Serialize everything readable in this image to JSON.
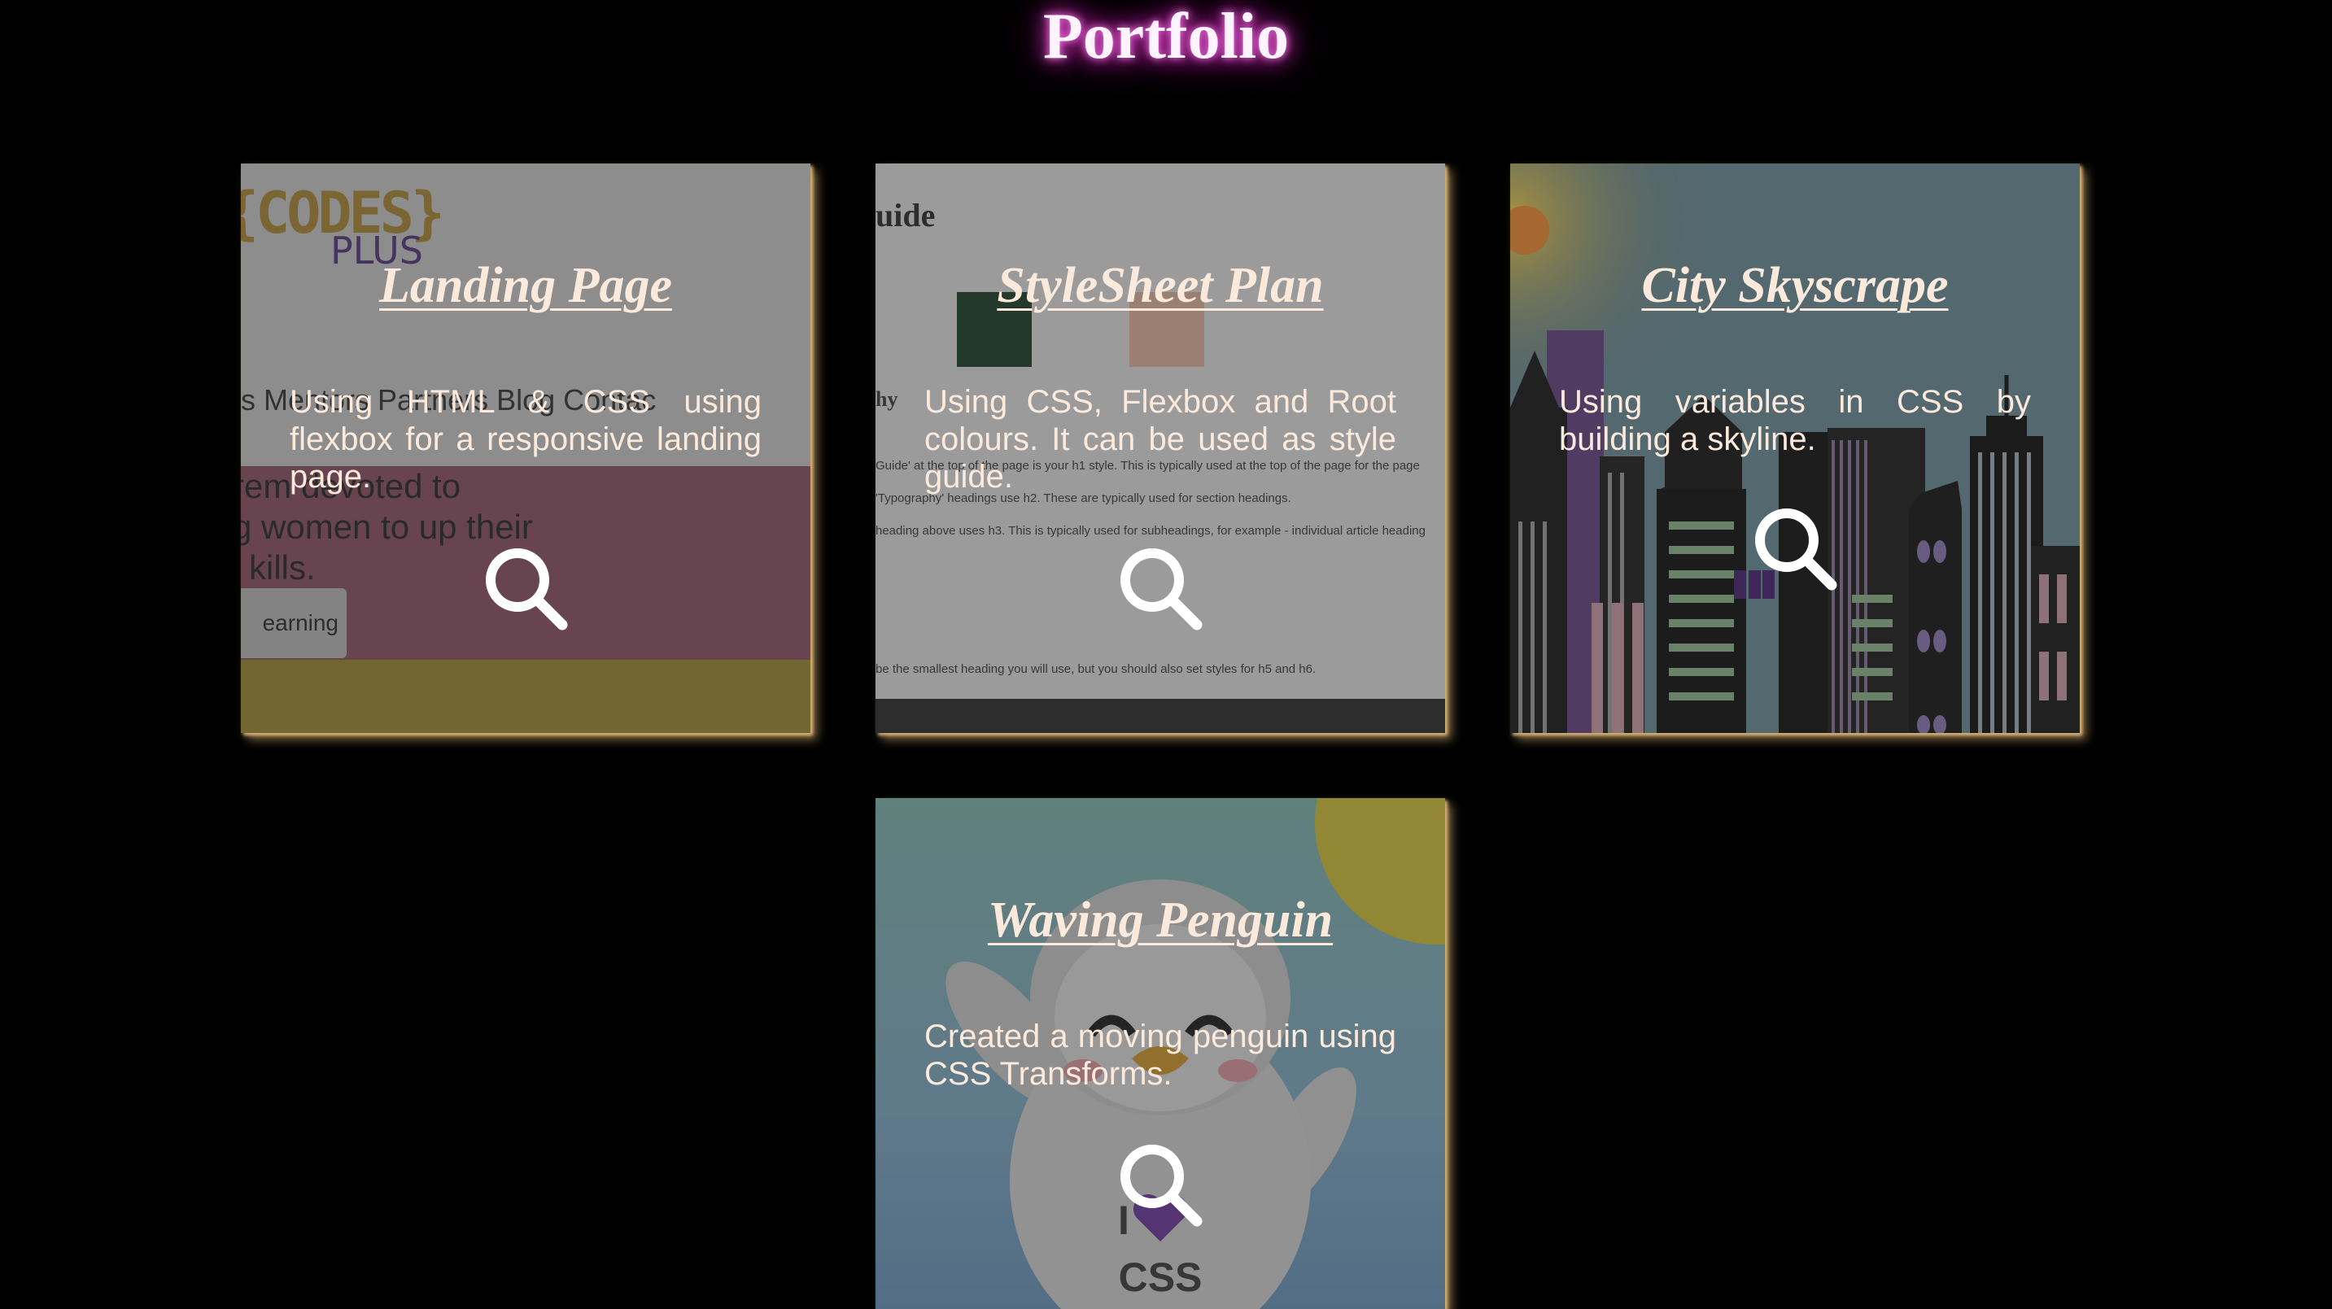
{
  "page": {
    "title": "Portfolio"
  },
  "projects": [
    {
      "title": "Landing Page",
      "description": "Using HTML & CSS using flexbox for a responsive landing page.",
      "icon": "search-icon"
    },
    {
      "title": "StyleSheet Plan",
      "description": "Using CSS, Flexbox and Root colours. It can be used as style guide.",
      "icon": "search-icon"
    },
    {
      "title": "City Skyscrape",
      "description": "Using variables in CSS by building a skyline.",
      "icon": "search-icon"
    },
    {
      "title": "Waving Penguin",
      "description": "Created a moving penguin using CSS Transforms.",
      "icon": "search-icon"
    }
  ],
  "previews": {
    "landing": {
      "logo_text": "{CODES}",
      "logo_sub": "PLUS",
      "nav": "s   Mentors   Partners   Blog   Contac",
      "hero_text": [
        "rem devoted to",
        "g women to up their",
        "kills."
      ],
      "button": "earning"
    },
    "stylesheet": {
      "heading": "uide",
      "side_label": "hy",
      "lines": [
        "Guide' at the top of the page is your h1 style. This is typically used at the top of the page for the page",
        "'Typography' headings use h2. These are typically used for section headings.",
        "heading above uses h3. This is typically used for subheadings, for example - individual article heading",
        "",
        "be the smallest heading you will use, but you should also set styles for h5 and h6."
      ]
    },
    "penguin": {
      "shirt_text_1": "I",
      "shirt_text_2": "CSS"
    }
  },
  "colors": {
    "background": "#000000",
    "title_glow": "#ff3fdc",
    "card_text": "#fbeadc",
    "card_shadow": "#d9b27a"
  }
}
